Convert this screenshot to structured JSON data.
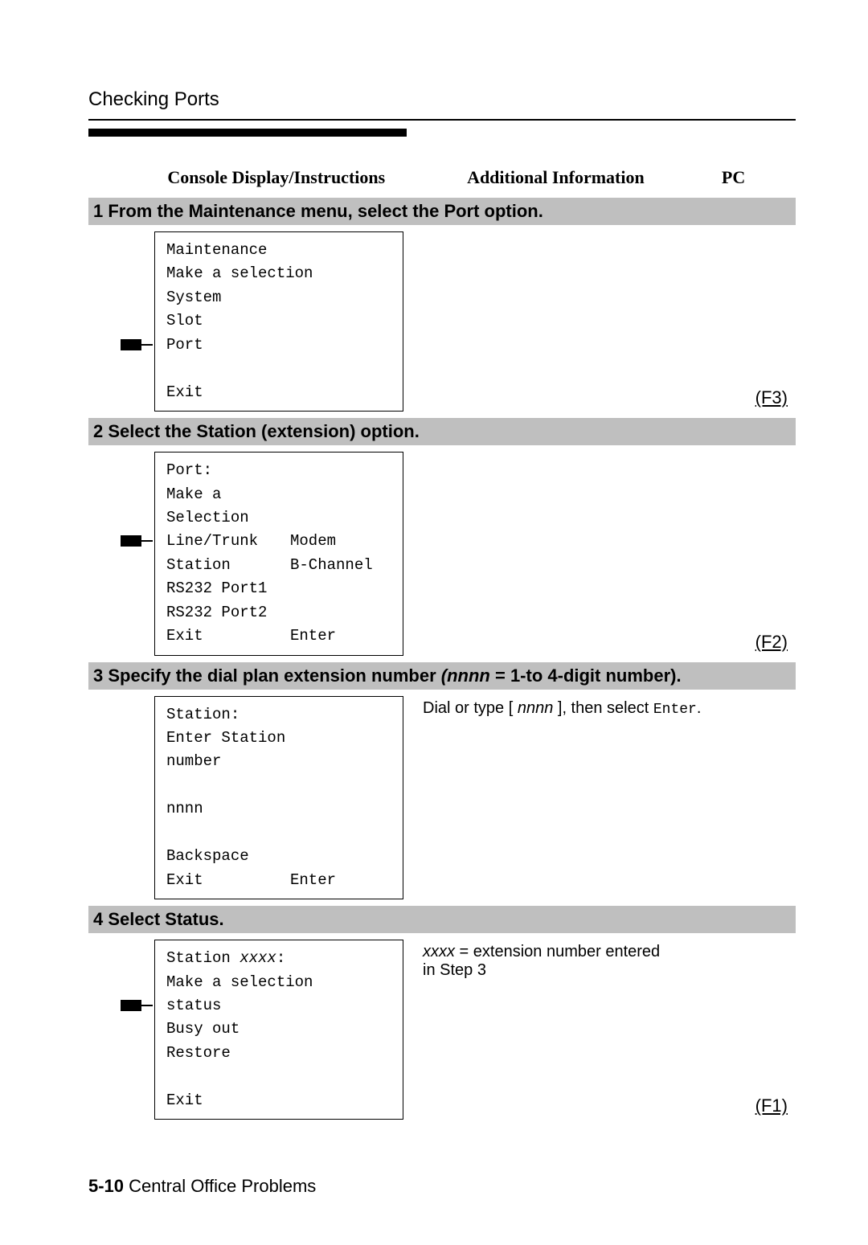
{
  "page_heading": "Checking Ports",
  "columns": {
    "left": "Console Display/Instructions",
    "mid": "Additional Information",
    "right": "PC"
  },
  "steps": [
    {
      "bar": "1 From the Maintenance menu, select the Port option.",
      "console_type": "simple",
      "console_lines": [
        "Maintenance",
        "Make a selection",
        "System",
        "Slot",
        "Port",
        "",
        "Exit"
      ],
      "pointer_line_index": 4,
      "info": "",
      "pc_label": "(F3)"
    },
    {
      "bar": "2 Select the Station (extension) option.",
      "console_type": "twocol",
      "console_rows": [
        {
          "c1": "Port:",
          "c2": ""
        },
        {
          "c1": "Make a Selection",
          "c2": ""
        },
        {
          "c1": "Line/Trunk",
          "c2": "Modem"
        },
        {
          "c1": "Station",
          "c2": "B-Channel"
        },
        {
          "c1": "RS232 Port1",
          "c2": ""
        },
        {
          "c1": "RS232 Port2",
          "c2": ""
        },
        {
          "c1": "Exit",
          "c2": "Enter"
        }
      ],
      "pointer_line_index": 3,
      "info": "",
      "pc_label": "(F2)"
    },
    {
      "bar_html": "3 Specify the dial plan extension number <em>(nnnn</em> = 1-to 4-digit number).",
      "console_type": "twocol",
      "console_rows": [
        {
          "c1": "Station:",
          "c2": ""
        },
        {
          "c1": "Enter Station number",
          "c2": ""
        },
        {
          "c1": "",
          "c2": ""
        },
        {
          "c1": "nnnn",
          "c2": ""
        },
        {
          "c1": "",
          "c2": ""
        },
        {
          "c1": "Backspace",
          "c2": ""
        },
        {
          "c1": "Exit",
          "c2": "Enter"
        }
      ],
      "pointer_line_index": null,
      "info_html": "Dial or type [ <span class='ital'>nnnn</span> ], then select <span class='mono'>Enter</span>.",
      "pc_label": ""
    },
    {
      "bar": "4 Select Status.",
      "console_type": "simple",
      "console_lines": [
        "Station xxxx:",
        "Make a selection",
        "status",
        "Busy out",
        "Restore",
        "",
        "Exit"
      ],
      "console_ital_indices": [
        0
      ],
      "pointer_line_index": 2,
      "info_html": "<span class='ital'>xxxx</span> = extension number entered<br>in Step 3",
      "pc_label": "(F1)"
    }
  ],
  "footer": {
    "bold": "5-10",
    "rest": " Central Office Problems"
  }
}
